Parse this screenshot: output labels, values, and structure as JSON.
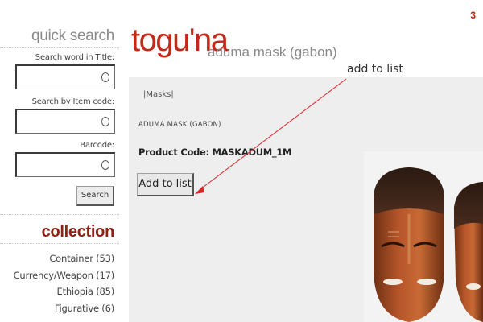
{
  "page": {
    "number": "3"
  },
  "sidebar": {
    "quick_search": {
      "title": "quick search",
      "fields": [
        {
          "label": "Search word in Title:",
          "value": ""
        },
        {
          "label": "Search by Item code:",
          "value": ""
        },
        {
          "label": "Barcode:",
          "value": ""
        }
      ],
      "search_button": "Search"
    },
    "collection": {
      "title": "collection",
      "items": [
        {
          "label": "Container (53)"
        },
        {
          "label": "Currency/Weapon (17)"
        },
        {
          "label": "Ethiopia (85)"
        },
        {
          "label": "Figurative (6)"
        }
      ]
    }
  },
  "header": {
    "logo": "togu'na",
    "subtitle": "aduma mask (gabon)"
  },
  "product": {
    "breadcrumb": "|Masks|",
    "title": "ADUMA MASK (GABON)",
    "product_code": "Product Code: MASKADUM_1M",
    "add_button": "Add to list"
  },
  "annotation": {
    "label": "add to list",
    "color": "#d9262b"
  },
  "colors": {
    "brand": "#c12a19",
    "collection_title": "#8b2416",
    "panel_bg": "#eeeeee",
    "page_number": "#d21a0b"
  },
  "icons": [
    "circle-icon",
    "arrow-head-icon"
  ]
}
